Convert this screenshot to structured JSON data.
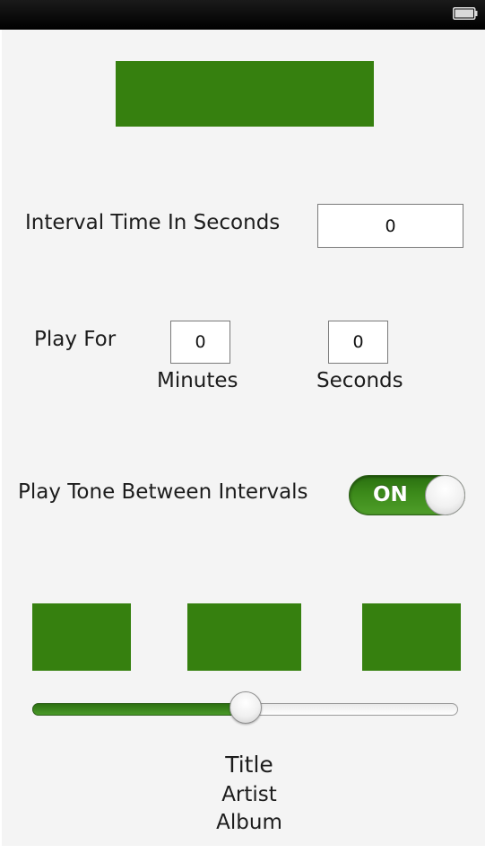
{
  "status_bar": {
    "battery_icon": "battery-icon"
  },
  "colors": {
    "accent_green": "#36800f",
    "background": "#f4f4f4"
  },
  "interval": {
    "label": "Interval Time In Seconds",
    "value": "0"
  },
  "play_for": {
    "label": "Play For",
    "minutes_value": "0",
    "minutes_label": "Minutes",
    "seconds_value": "0",
    "seconds_label": "Seconds"
  },
  "tone": {
    "label": "Play Tone Between Intervals",
    "toggle_text": "ON",
    "is_on": true
  },
  "playback": {
    "progress_percent": 50
  },
  "now_playing": {
    "title": "Title",
    "artist": "Artist",
    "album": "Album"
  }
}
